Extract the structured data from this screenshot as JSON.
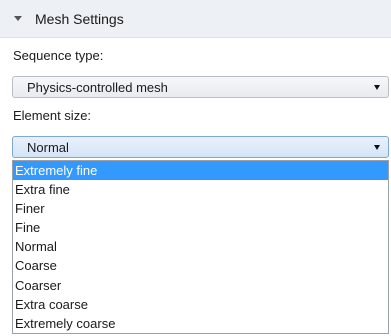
{
  "section": {
    "title": "Mesh Settings"
  },
  "sequence_type": {
    "label": "Sequence type:",
    "value": "Physics-controlled mesh"
  },
  "element_size": {
    "label": "Element size:",
    "value": "Normal",
    "options": [
      "Extremely fine",
      "Extra fine",
      "Finer",
      "Fine",
      "Normal",
      "Coarse",
      "Coarser",
      "Extra coarse",
      "Extremely coarse"
    ],
    "highlighted_option": "Extremely fine"
  },
  "colors": {
    "highlight": "#3399ff",
    "header_bg": "#edf0f4"
  }
}
